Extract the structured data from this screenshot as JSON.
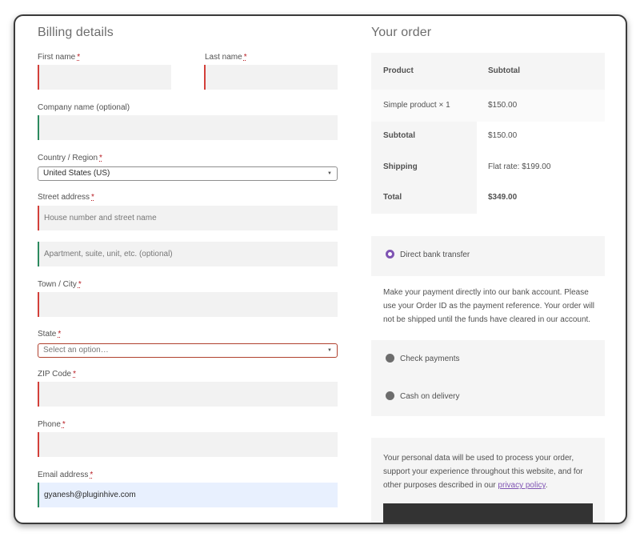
{
  "billing": {
    "title": "Billing details",
    "required_marker": "*",
    "first_name": {
      "label": "First name",
      "value": ""
    },
    "last_name": {
      "label": "Last name",
      "value": ""
    },
    "company": {
      "label": "Company name (optional)",
      "value": ""
    },
    "country": {
      "label": "Country / Region",
      "value": "United States (US)"
    },
    "street": {
      "label": "Street address",
      "placeholder1": "House number and street name",
      "placeholder2": "Apartment, suite, unit, etc. (optional)"
    },
    "city": {
      "label": "Town / City",
      "value": ""
    },
    "state": {
      "label": "State",
      "placeholder": "Select an option…"
    },
    "zip": {
      "label": "ZIP Code",
      "value": ""
    },
    "phone": {
      "label": "Phone",
      "value": ""
    },
    "email": {
      "label": "Email address",
      "value": "gyanesh@pluginhive.com"
    }
  },
  "order": {
    "title": "Your order",
    "header": {
      "product": "Product",
      "subtotal": "Subtotal"
    },
    "item": {
      "name": "Simple product",
      "qty": "× 1",
      "price": "$150.00"
    },
    "subtotal": {
      "label": "Subtotal",
      "value": "$150.00"
    },
    "shipping": {
      "label": "Shipping",
      "value": "Flat rate: $199.00"
    },
    "total": {
      "label": "Total",
      "value": "$349.00"
    }
  },
  "payment": {
    "methods": [
      {
        "label": "Direct bank transfer",
        "selected": true
      },
      {
        "label": "Check payments",
        "selected": false
      },
      {
        "label": "Cash on delivery",
        "selected": false
      }
    ],
    "description": "Make your payment directly into our bank account. Please use your Order ID as the payment reference. Your order will not be shipped until the funds have cleared in our account."
  },
  "privacy": {
    "text": "Your personal data will be used to process your order, support your experience throughout this website, and for other purposes described in our",
    "link": "privacy policy",
    "end": "."
  },
  "colors": {
    "accent": "#7f54b3",
    "required": "#b81c23",
    "invalid_border": "#d3403a",
    "valid_border": "#2c8a5f"
  }
}
